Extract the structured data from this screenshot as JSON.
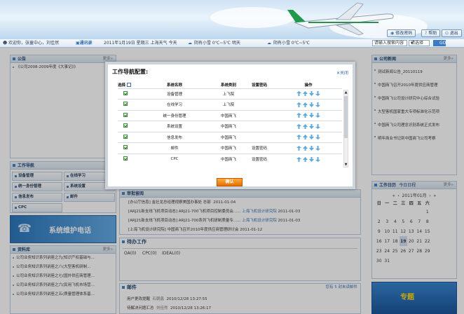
{
  "header": {
    "buttons": [
      "修改密码",
      "帮助",
      "退出"
    ]
  },
  "infobar": {
    "welcome": "欢迎你，张童中心，刘佳然",
    "address_book": "通讯录",
    "date": "2011年1月19日 星期三 上海天气 今天",
    "weather1": "阴有小雪  0℃~5℃ 明天",
    "weather2": "阴有小雪  0℃~5℃",
    "search_placeholder": "请输入搜索内容",
    "search_scope": "请选择",
    "go_label": "GO"
  },
  "left": {
    "notice_title": "公告",
    "notice_items": [
      "《公司2008-2009年度《大事记》》"
    ],
    "more": "更多»",
    "worknav_title": "工作导航",
    "config_label": "配",
    "nav_items": [
      "设备管理",
      "在线学习",
      "统一身份管理",
      "系统设置",
      "信息发布",
      "邮件",
      "CPC"
    ],
    "banner": "系统维护电话",
    "library_title": "资料库",
    "library_items": [
      "公司业务知识系列讲座之九(知识产权基础与...",
      "公司业务知识系列讲座之八(大型客机研制...",
      "公司业务知识系列讲座之七(国外供应商管理...",
      "公司业务知识系列讲座之六(民用飞机市场营...",
      "公司业务知识系列讲座之五(质量管理体系基..."
    ]
  },
  "middle": {
    "approval_title": "审批留阅",
    "approval_rows": [
      {
        "text": "[办公厅信息] 金壮龙总经理视察美国办事处  总部",
        "date": "2011-01-04"
      },
      {
        "text": "[ARJ21新支线飞机项目动态] ARJ21-700飞机项目控制委员会......",
        "org": "上海飞机设计研究院",
        "date": "2011-01-03"
      },
      {
        "text": "[ARJ21新支线飞机项目动态] ARJ21-700系列飞机研制质量专......",
        "org": "上海飞机设计研究院",
        "date": "2011-01-03"
      },
      {
        "text": "[上海飞机设计研究院] 中国商飞召开2010年度供应商管理研讨会",
        "date": "2011-01-12"
      }
    ],
    "pending_title": "待办工作",
    "pending_tabs": [
      "OA(0)",
      "CPC(0)",
      "IDEAL(0)"
    ],
    "mail_title": "邮件",
    "mail_summary": "您有 5 封未读邮件",
    "mail_rows": [
      {
        "subject": "用户更改提醒",
        "sender": "石朝鑫",
        "date": "2010/12/28 13:27:55"
      },
      {
        "subject": "待解决问题汇总",
        "sender": "刘佳然",
        "date": "2010/12/28 13:26:17"
      }
    ]
  },
  "right": {
    "news_title": "公司新闻",
    "more": "更多»",
    "news_items": [
      "测试新闻公告_20110119",
      "中国商飞召开2010年度供应商管理",
      "中国商飞公司设计研究中心综合试验",
      "大型客机国家重大专项标准化示范项",
      "中国商飞公司理念识别系统正式发布",
      "明年商业书记到中国商飞公司考察"
    ],
    "calendar_title": "工作日历",
    "today_label": "今日日程",
    "month": "2011年01月",
    "weekdays": [
      "日",
      "一",
      "二",
      "三",
      "四",
      "五",
      "六"
    ],
    "days": [
      "",
      "",
      "",
      "",
      "",
      "",
      "1",
      "2",
      "3",
      "4",
      "5",
      "6",
      "7",
      "8",
      "9",
      "10",
      "11",
      "12",
      "13",
      "14",
      "15",
      "16",
      "17",
      "18",
      "19",
      "20",
      "21",
      "22",
      "23",
      "24",
      "25",
      "26",
      "27",
      "28",
      "29",
      "30",
      "31"
    ],
    "today": "19",
    "banner": "专题"
  },
  "dialog": {
    "title": "工作导航配置:",
    "close_label": "关闭",
    "columns": [
      "选择",
      "系统名称",
      "系统类别",
      "设置密码",
      "操作"
    ],
    "rows": [
      {
        "name": "设备管理",
        "category": "上飞院",
        "password": ""
      },
      {
        "name": "在线学习",
        "category": "上飞院",
        "password": ""
      },
      {
        "name": "统一身份管理",
        "category": "中国商飞",
        "password": ""
      },
      {
        "name": "系统设置",
        "category": "中国商飞",
        "password": ""
      },
      {
        "name": "信息发布",
        "category": "中国商飞",
        "password": ""
      },
      {
        "name": "邮件",
        "category": "中国商飞",
        "password": "设置密码"
      },
      {
        "name": "CPC",
        "category": "中国商飞",
        "password": "设置密码"
      }
    ],
    "confirm_label": "确认",
    "colors": {
      "accent": "#2e6cb3",
      "confirm": "#f08a10",
      "check": "#3f8b3f"
    }
  }
}
